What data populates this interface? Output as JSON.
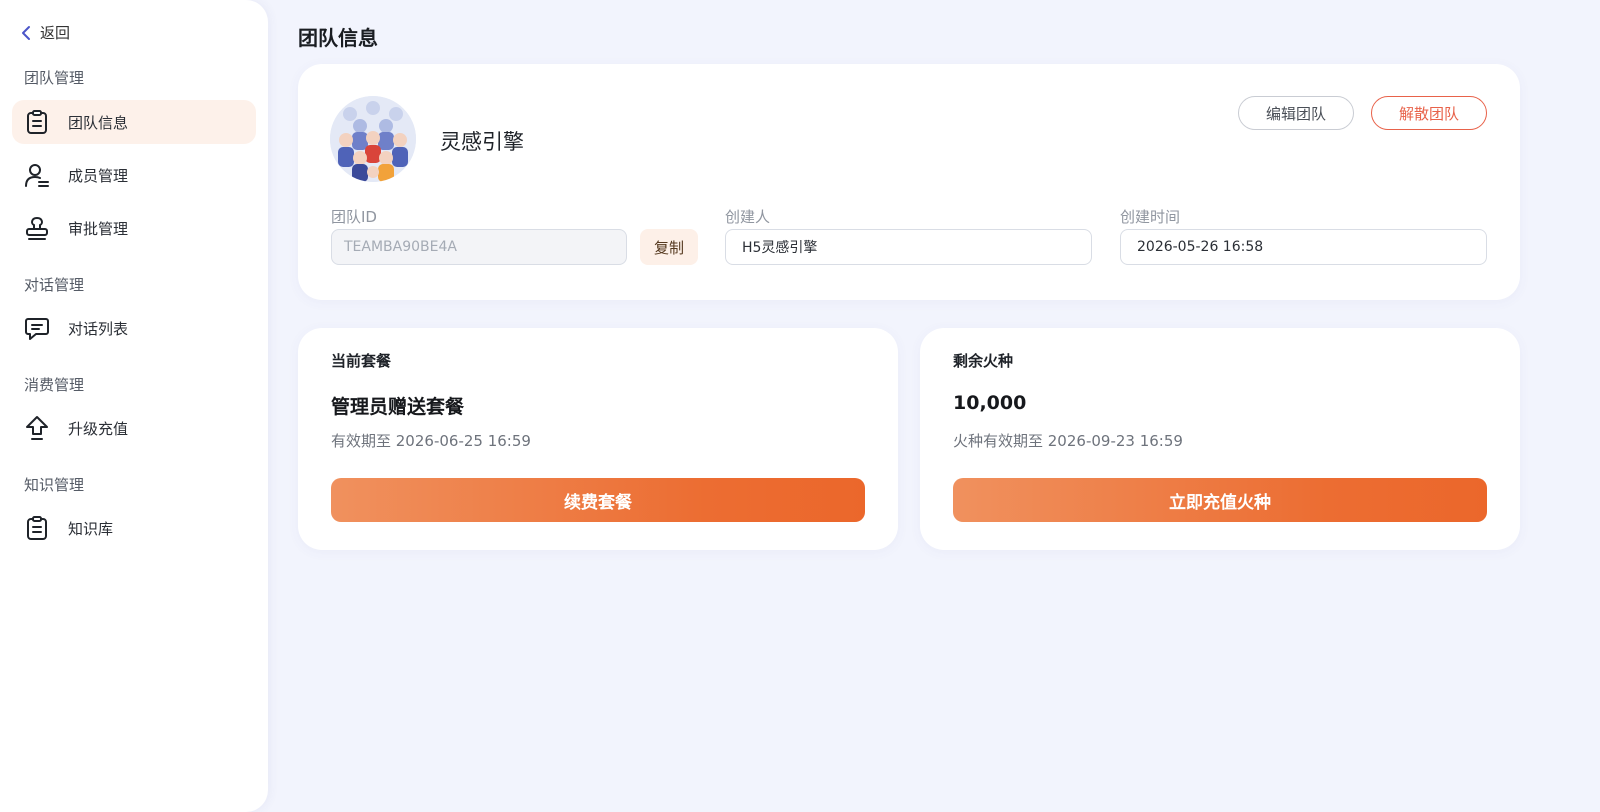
{
  "sidebar": {
    "back_label": "返回",
    "sections": [
      {
        "title": "团队管理",
        "items": [
          {
            "label": "团队信息",
            "icon": "clipboard-icon",
            "active": true
          },
          {
            "label": "成员管理",
            "icon": "user-list-icon",
            "active": false
          },
          {
            "label": "审批管理",
            "icon": "stamp-icon",
            "active": false
          }
        ]
      },
      {
        "title": "对话管理",
        "items": [
          {
            "label": "对话列表",
            "icon": "chat-icon",
            "active": false
          }
        ]
      },
      {
        "title": "消费管理",
        "items": [
          {
            "label": "升级充值",
            "icon": "upload-arrow-icon",
            "active": false
          }
        ]
      },
      {
        "title": "知识管理",
        "items": [
          {
            "label": "知识库",
            "icon": "clipboard-icon",
            "active": false
          }
        ]
      }
    ]
  },
  "page_title": "团队信息",
  "team": {
    "name": "灵感引擎",
    "edit_label": "编辑团队",
    "dissolve_label": "解散团队",
    "id_label": "团队ID",
    "id_value": "TEAMBA90BE4A",
    "copy_label": "复制",
    "creator_label": "创建人",
    "creator_value": "H5灵感引擎",
    "created_label": "创建时间",
    "created_value": "2026-05-26 16:58"
  },
  "plan": {
    "title": "当前套餐",
    "name": "管理员赠送套餐",
    "expiry": "有效期至 2026-06-25 16:59",
    "button": "续费套餐"
  },
  "sparks": {
    "title": "剩余火种",
    "value": "10,000",
    "expiry": "火种有效期至 2026-09-23 16:59",
    "button": "立即充值火种"
  },
  "colors": {
    "accent": "#ec6d32",
    "danger": "#e8624a",
    "active_bg": "#fdf1ea",
    "page_bg": "#f2f4fd"
  }
}
